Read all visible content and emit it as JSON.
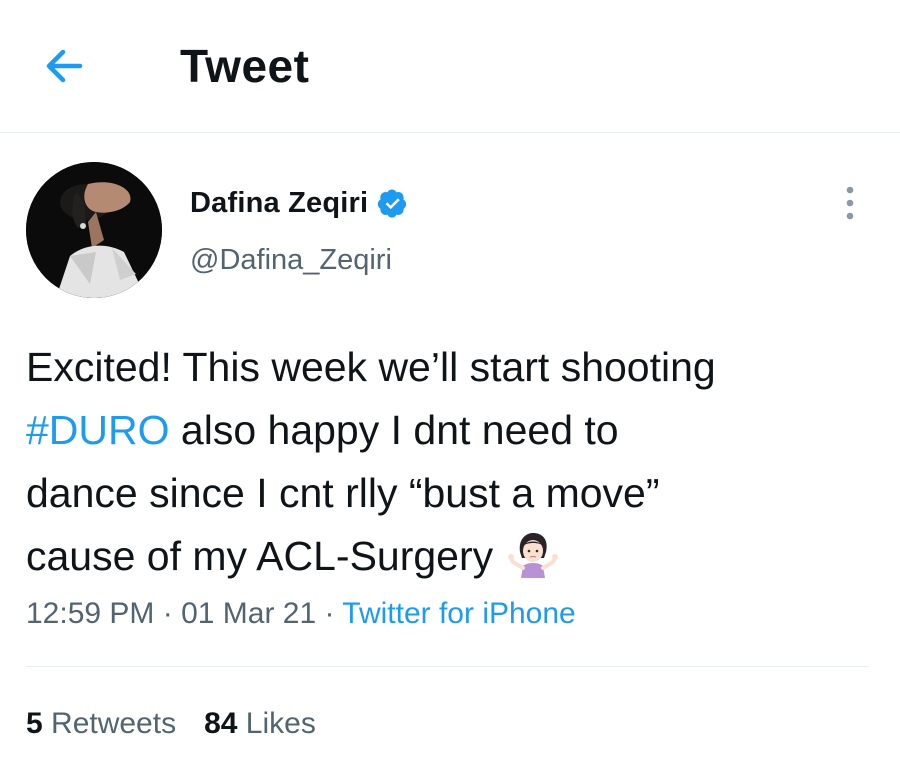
{
  "header": {
    "title": "Tweet",
    "back_icon": "arrow-left-icon"
  },
  "author": {
    "display_name": "Dafina Zeqiri",
    "handle": "@Dafina_Zeqiri",
    "verified_icon": "verified-badge-icon",
    "more_icon": "vertical-dots-icon"
  },
  "tweet": {
    "text_line1": "Excited! This week we’ll start shooting",
    "hashtag": "#DURO",
    "text_line2_rest": " also happy I dnt need to",
    "text_line3": "dance since I cnt rlly “bust a move”",
    "text_line4": "cause of my ACL-Surgery",
    "emoji": "woman-shrugging-icon"
  },
  "meta": {
    "time": "12:59 PM",
    "sep1": " · ",
    "date": "01 Mar 21",
    "sep2": " · ",
    "source": "Twitter for iPhone"
  },
  "stats": {
    "retweets_count": "5",
    "retweets_label": " Retweets",
    "likes_count": "84",
    "likes_label": " Likes"
  },
  "colors": {
    "accent": "#1d9bf0",
    "secondary_text": "#536471",
    "primary_text": "#0f1419",
    "divider": "#e6ecf0"
  }
}
